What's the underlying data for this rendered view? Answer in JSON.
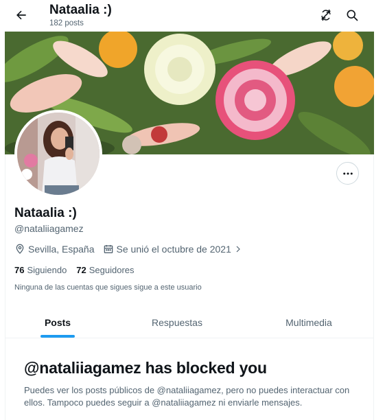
{
  "header": {
    "title": "Nataalia :)",
    "posts_count": "182 posts"
  },
  "profile": {
    "name": "Nataalia :)",
    "handle": "@nataliiagamez",
    "location": "Sevilla, España",
    "joined": "Se unió el octubre de 2021",
    "following_count": "76",
    "following_label": "Siguiendo",
    "followers_count": "72",
    "followers_label": "Seguidores",
    "followers_note": "Ninguna de las cuentas que sigues sigue a este usuario"
  },
  "tabs": [
    {
      "label": "Posts",
      "active": true
    },
    {
      "label": "Respuestas",
      "active": false
    },
    {
      "label": "Multimedia",
      "active": false
    }
  ],
  "blocked": {
    "title": "@nataliiagamez has blocked you",
    "message": "Puedes ver los posts públicos de @nataliiagamez, pero no puedes interactuar con ellos. Tampoco puedes seguir a @nataliiagamez ni enviarle mensajes."
  },
  "icons": {
    "back": "arrow-left-icon",
    "refresh": "refresh-icon",
    "search": "search-icon",
    "more": "more-horizontal-icon",
    "location": "location-pin-icon",
    "calendar": "calendar-icon"
  },
  "colors": {
    "accent": "#1d9bf0",
    "text": "#0f1419",
    "muted": "#536471"
  }
}
